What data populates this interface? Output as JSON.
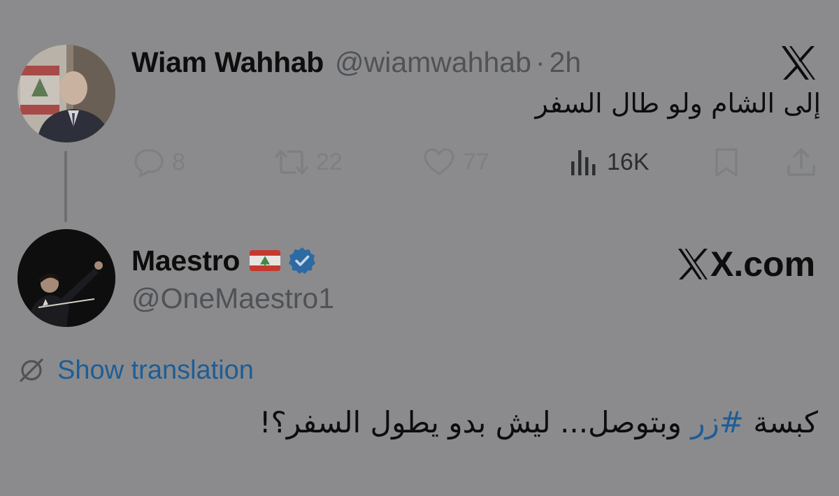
{
  "colors": {
    "overlay_background": "#8b8b8d",
    "text_primary": "#0d0d0d",
    "text_secondary": "#4f5256",
    "action_gray": "#7d7f82",
    "link_blue": "#1e5d96",
    "verified_blue": "#2c6aa3"
  },
  "parent_tweet": {
    "display_name": "Wiam Wahhab",
    "handle": "@wiamwahhab",
    "separator": "·",
    "time": "2h",
    "text": "إلى الشام ولو طال السفر",
    "platform_icon": "x-logo-icon",
    "actions": {
      "reply": {
        "icon": "reply-icon",
        "count": "8"
      },
      "repost": {
        "icon": "repost-icon",
        "count": "22"
      },
      "like": {
        "icon": "heart-icon",
        "count": "77"
      },
      "views": {
        "icon": "views-chart-icon",
        "count": "16K"
      },
      "bookmark": {
        "icon": "bookmark-icon"
      },
      "share": {
        "icon": "share-icon"
      }
    }
  },
  "reply_tweet": {
    "display_name": "Maestro",
    "flag_icon": "lebanon-flag-icon",
    "verified_icon": "verified-badge-icon",
    "handle": "@OneMaestro1",
    "watermark": "X.com",
    "translate_icon": "translate-globe-icon",
    "show_translation": "Show translation",
    "text_before_hashtag": "كبسة ",
    "hashtag": "#زر",
    "text_after_hashtag": " وبتوصل... ليش بدو يطول السفر؟!"
  }
}
